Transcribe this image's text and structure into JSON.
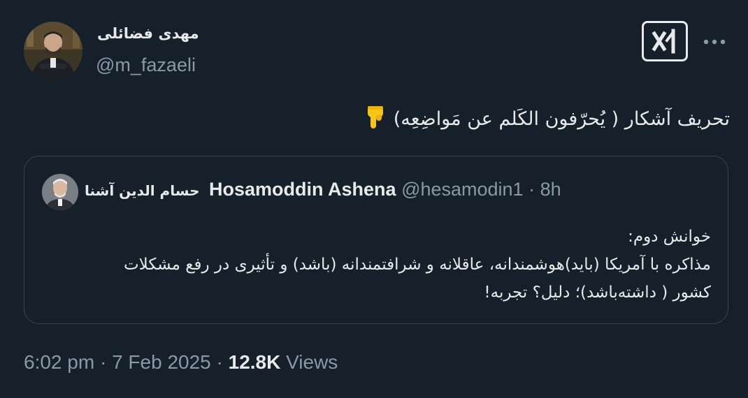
{
  "author": {
    "name": "مهدی فضائلی",
    "handle": "@m_fazaeli",
    "avatar_icon": "author-avatar"
  },
  "header_actions": {
    "grok_icon": "grok-icon",
    "more_icon": "more-icon"
  },
  "tweet": {
    "text": "تحریف آشکار ( یُحرّفون الکَلم عن مَواضِعِه)",
    "emoji": "pointing-down-emoji"
  },
  "quote": {
    "name_fa": "حسام الدین آشنا",
    "name_en": "Hosamoddin Ashena",
    "handle": "@hesamodin1",
    "separator": "·",
    "time": "8h",
    "lines": [
      "خوانش دوم:",
      "مذاکره با آمریکا (باید)هوشمندانه، عاقلانه و شرافتمندانه (باشد) و  تأثیری در رفع مشکلات",
      "کشور ( داشته‌باشد)؛ دلیل؟ تجربه!"
    ]
  },
  "meta": {
    "time": "6:02 pm",
    "sep1": " · ",
    "date": "7 Feb 2025",
    "sep2": " · ",
    "views_count": "12.8K",
    "views_label": " Views"
  },
  "colors": {
    "background": "#15202b",
    "text": "#e7e9ea",
    "secondary": "#8b98a5",
    "border": "#38444d",
    "emoji": "#f5c518"
  }
}
